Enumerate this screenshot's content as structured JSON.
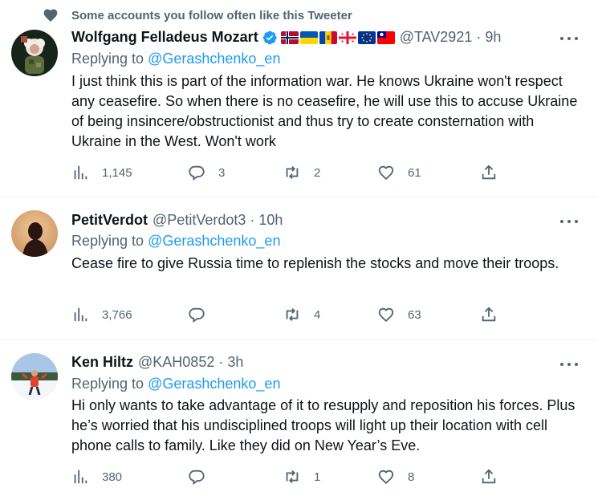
{
  "social_context": "Some accounts you follow often like this Tweeter",
  "tweets": [
    {
      "name": "Wolfgang Felladeus Mozart",
      "handle": "@TAV2921",
      "time": "9h",
      "reply_prefix": "Replying to",
      "reply_to": "@Gerashchenko_en",
      "text": "I just think this is part of the information war. He knows Ukraine won't respect any ceasefire. So when there is no ceasefire, he will use this to accuse Ukraine of being insincere/obstructionist and thus try to create consternation with Ukraine in the West. Won't work",
      "views": "1,145",
      "replies": "3",
      "retweets": "2",
      "likes": "61"
    },
    {
      "name": "PetitVerdot",
      "handle": "@PetitVerdot3",
      "time": "10h",
      "reply_prefix": "Replying to",
      "reply_to": "@Gerashchenko_en",
      "text": "Cease fire to give Russia time to replenish the stocks and move their troops.",
      "views": "3,766",
      "replies": "",
      "retweets": "4",
      "likes": "63"
    },
    {
      "name": "Ken Hiltz",
      "handle": "@KAH0852",
      "time": "3h",
      "reply_prefix": "Replying to",
      "reply_to": "@Gerashchenko_en",
      "text": "Hi only wants to take advantage of it to resupply and reposition his forces. Plus he’s worried that his undisciplined troops will light up their location with cell phone calls to family. Like they did on New Year’s Eve.",
      "views": "380",
      "replies": "",
      "retweets": "1",
      "likes": "8"
    }
  ],
  "dot": "·",
  "colors": {
    "link": "#1d9bf0",
    "secondary": "#536471",
    "text": "#0f1419",
    "verified": "#1d9bf0"
  },
  "icons": [
    "heart-icon",
    "verified-icon",
    "more-icon",
    "views-icon",
    "reply-icon",
    "retweet-icon",
    "like-icon",
    "share-icon"
  ]
}
